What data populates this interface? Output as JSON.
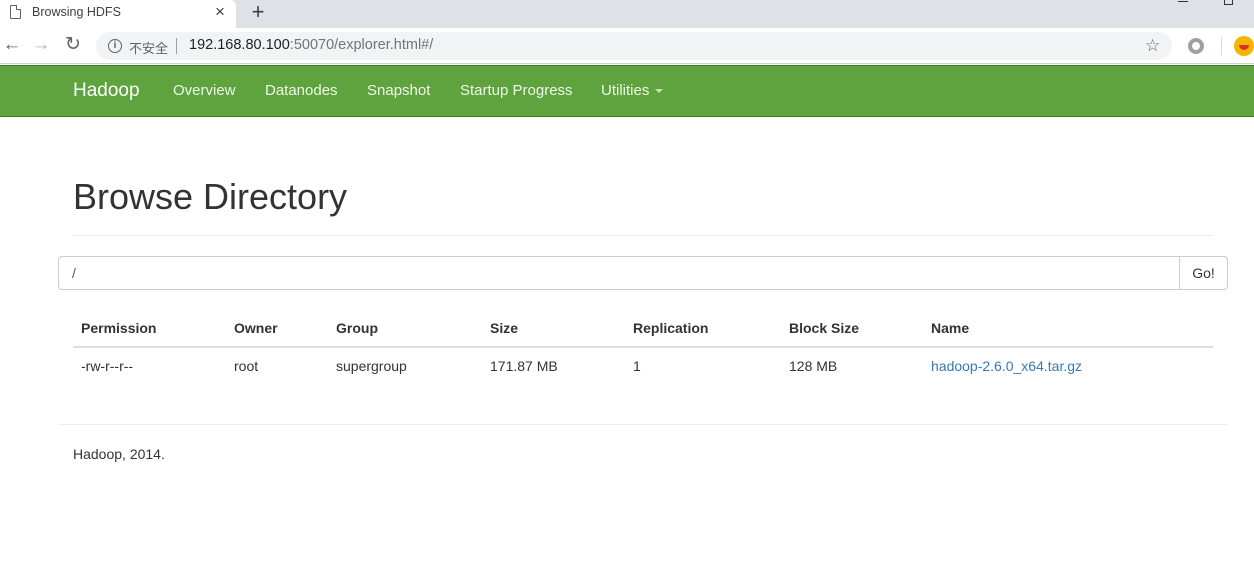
{
  "browser": {
    "tab_title": "Browsing HDFS",
    "tab_close": "×",
    "new_tab": "+",
    "insecure_label": "不安全",
    "url_host": "192.168.80.100",
    "url_rest": ":50070/explorer.html#/"
  },
  "navbar": {
    "brand": "Hadoop",
    "items": [
      {
        "label": "Overview"
      },
      {
        "label": "Datanodes"
      },
      {
        "label": "Snapshot"
      },
      {
        "label": "Startup Progress"
      },
      {
        "label": "Utilities"
      }
    ]
  },
  "page": {
    "title": "Browse Directory",
    "path_value": "/",
    "go_label": "Go!"
  },
  "table": {
    "headers": [
      "Permission",
      "Owner",
      "Group",
      "Size",
      "Replication",
      "Block Size",
      "Name"
    ],
    "rows": [
      {
        "permission": "-rw-r--r--",
        "owner": "root",
        "group": "supergroup",
        "size": "171.87 MB",
        "replication": "1",
        "block_size": "128 MB",
        "name": "hadoop-2.6.0_x64.tar.gz"
      }
    ]
  },
  "footer": {
    "text": "Hadoop, 2014."
  },
  "colors": {
    "navbar": "#5fa33e",
    "link": "#337ab7"
  }
}
